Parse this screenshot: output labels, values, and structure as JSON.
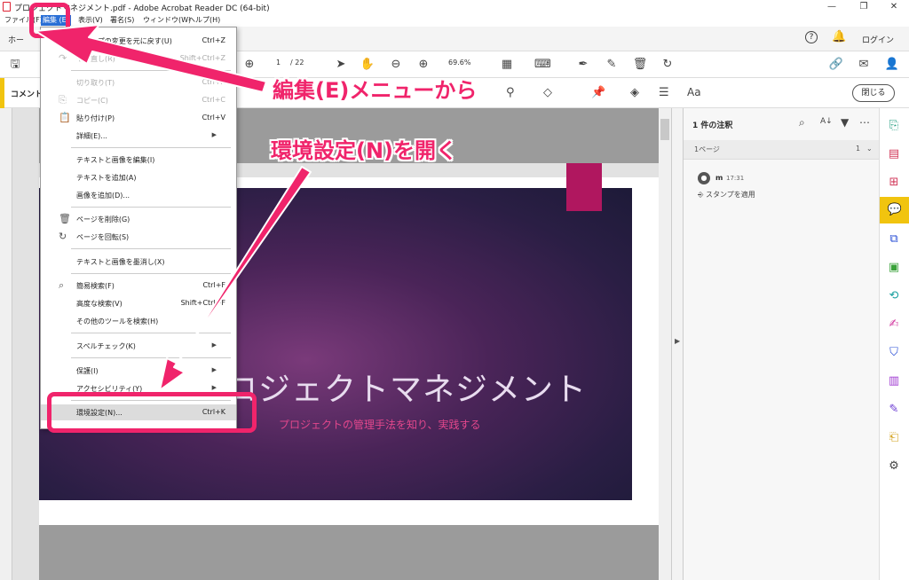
{
  "window": {
    "title": "プロジェクトマネジメント.pdf - Adobe Acrobat Reader DC (64-bit)",
    "minimize_icon": "minimize-icon",
    "restore_icon": "restore-icon",
    "close_icon": "close-icon"
  },
  "menubar": {
    "items": [
      "ファイル(F)",
      "編集 (E)",
      "表示(V)",
      "署名(S)",
      "ウィンドウ(W)",
      "ヘルプ(H)"
    ]
  },
  "tabrow": {
    "home": "ホー",
    "help_icon": "?",
    "bell_icon": "bell-icon",
    "login": "ログイン"
  },
  "toolbar": {
    "page_current": "1",
    "page_total": "/ 22",
    "zoom": "69.6%"
  },
  "commentbar": {
    "title": "コメント",
    "close": "閉じる"
  },
  "edit_menu": {
    "items": [
      {
        "label": "スタンプの変更を元に戻す(U)",
        "shortcut": "Ctrl+Z",
        "disabled": false
      },
      {
        "label": "やり直し(R)",
        "shortcut": "Shift+Ctrl+Z",
        "disabled": true
      },
      {
        "label": "切り取り(T)",
        "shortcut": "Ctrl+X",
        "disabled": true
      },
      {
        "label": "コピー(C)",
        "shortcut": "Ctrl+C",
        "disabled": true
      },
      {
        "label": "貼り付け(P)",
        "shortcut": "Ctrl+V",
        "disabled": false
      },
      {
        "label": "詳細(E)...",
        "shortcut": "",
        "disabled": false
      },
      {
        "label": "テキストと画像を編集(I)",
        "shortcut": "",
        "disabled": false
      },
      {
        "label": "テキストを追加(A)",
        "shortcut": "",
        "disabled": false
      },
      {
        "label": "画像を追加(D)...",
        "shortcut": "",
        "disabled": false
      },
      {
        "label": "ページを削除(G)",
        "shortcut": "",
        "disabled": false
      },
      {
        "label": "ページを回転(S)",
        "shortcut": "",
        "disabled": false
      },
      {
        "label": "テキストと画像を墨消し(X)",
        "shortcut": "",
        "disabled": false
      },
      {
        "label": "簡易検索(F)",
        "shortcut": "Ctrl+F",
        "disabled": false
      },
      {
        "label": "高度な検索(V)",
        "shortcut": "Shift+Ctrl+F",
        "disabled": false
      },
      {
        "label": "その他のツールを検索(H)",
        "shortcut": "",
        "disabled": false
      },
      {
        "label": "スペルチェック(K)",
        "shortcut": "",
        "disabled": false
      },
      {
        "label": "保護(I)",
        "shortcut": "",
        "disabled": false
      },
      {
        "label": "アクセシビリティ(Y)",
        "shortcut": "",
        "disabled": false
      },
      {
        "label": "環境設定(N)...",
        "shortcut": "Ctrl+K",
        "disabled": false
      }
    ]
  },
  "document": {
    "slide_title": "ロジェクトマネジメント",
    "slide_subtitle": "プロジェクトの管理手法を知り、実践する"
  },
  "comments_panel": {
    "header": "1 件の注釈",
    "page_label": "1ページ",
    "page_count": "1",
    "author": "m",
    "time": "17:31",
    "action": "スタンプを適用"
  },
  "annotations": {
    "text1": "編集(E)メニューから",
    "text2": "環境設定(N)を開く",
    "accent": "#f0246b"
  }
}
